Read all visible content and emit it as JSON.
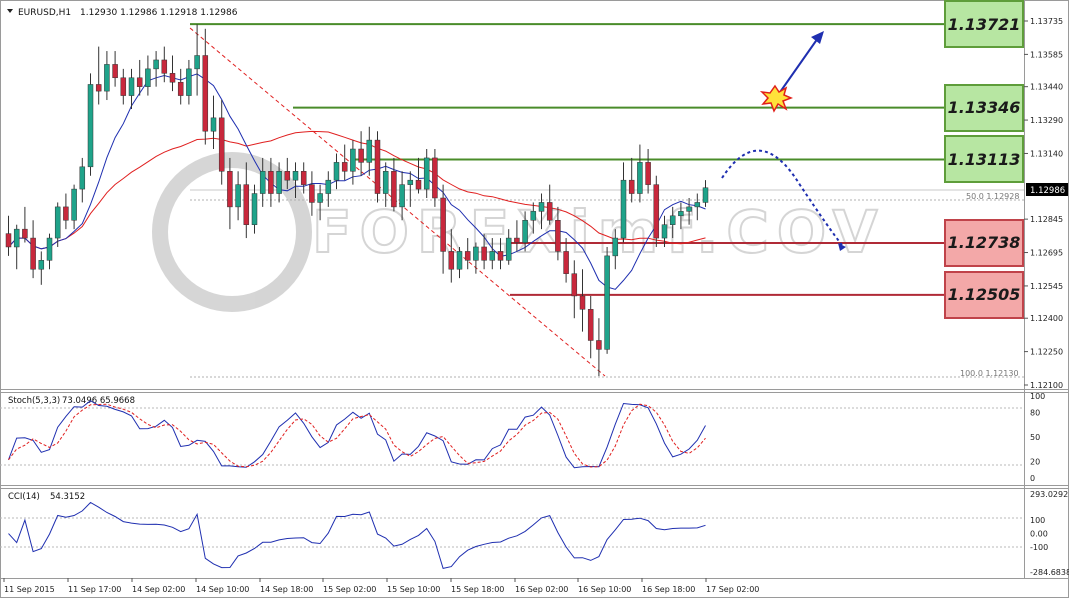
{
  "header": {
    "symbol": "EURUSD,H1",
    "ohlc": "1.12930 1.12986 1.12918 1.12986"
  },
  "price_axis": {
    "ticks": [
      "1.13735",
      "1.13585",
      "1.13440",
      "1.13290",
      "1.13140",
      "1.12845",
      "1.12695",
      "1.12545",
      "1.12400",
      "1.12250",
      "1.12100"
    ],
    "current_price": "1.12986"
  },
  "fibo": {
    "top_label": "50.0  1.12928",
    "bottom_label": "100.0  1.12130"
  },
  "levels": [
    {
      "price": "1.13721",
      "kind": "resistance"
    },
    {
      "price": "1.13346",
      "kind": "resistance"
    },
    {
      "price": "1.13113",
      "kind": "resistance"
    },
    {
      "price": "1.12738",
      "kind": "support"
    },
    {
      "price": "1.12505",
      "kind": "support"
    }
  ],
  "stoch": {
    "label": "Stoch(5,3,3)",
    "values": "73.0496 65.9668",
    "ticks": [
      "100",
      "80",
      "50",
      "20",
      "0"
    ]
  },
  "cci": {
    "label": "CCI(14)",
    "value": "54.3152",
    "ticks": [
      "293.0292",
      "100",
      "0.00",
      "-100",
      "-284.6838"
    ]
  },
  "time_axis": {
    "labels": [
      "11 Sep 2015",
      "11 Sep 17:00",
      "14 Sep 02:00",
      "14 Sep 10:00",
      "14 Sep 18:00",
      "15 Sep 02:00",
      "15 Sep 10:00",
      "15 Sep 18:00",
      "16 Sep 02:00",
      "16 Sep 10:00",
      "16 Sep 18:00",
      "17 Sep 02:00"
    ]
  },
  "colors": {
    "bull_candle": "#1fa38a",
    "bear_candle": "#c8283c",
    "ma_fast": "#1f2fb0",
    "ma_slow": "#e02020",
    "stoch_main": "#1f2fb0",
    "stoch_signal": "#e02020",
    "resistance_line": "#4a8c2a",
    "support_line": "#b02a36",
    "forecast_arrow": "#1f2fb0"
  },
  "chart_data": {
    "type": "candlestick",
    "ohlc": [
      [
        1.1278,
        1.1286,
        1.1268,
        1.1272
      ],
      [
        1.1272,
        1.1282,
        1.1262,
        1.128
      ],
      [
        1.128,
        1.129,
        1.1274,
        1.1276
      ],
      [
        1.1276,
        1.1284,
        1.1258,
        1.1262
      ],
      [
        1.1262,
        1.127,
        1.1255,
        1.1266
      ],
      [
        1.1266,
        1.1278,
        1.1262,
        1.1276
      ],
      [
        1.1276,
        1.1292,
        1.1272,
        1.129
      ],
      [
        1.129,
        1.1296,
        1.128,
        1.1284
      ],
      [
        1.1284,
        1.13,
        1.128,
        1.1298
      ],
      [
        1.1298,
        1.1312,
        1.1292,
        1.1308
      ],
      [
        1.1308,
        1.135,
        1.1304,
        1.1345
      ],
      [
        1.1345,
        1.1362,
        1.1336,
        1.1342
      ],
      [
        1.1342,
        1.136,
        1.1338,
        1.1354
      ],
      [
        1.1354,
        1.136,
        1.1344,
        1.1348
      ],
      [
        1.1348,
        1.1352,
        1.1336,
        1.134
      ],
      [
        1.134,
        1.1352,
        1.1334,
        1.1348
      ],
      [
        1.1348,
        1.1356,
        1.134,
        1.1344
      ],
      [
        1.1344,
        1.1358,
        1.134,
        1.1352
      ],
      [
        1.1352,
        1.136,
        1.1344,
        1.1356
      ],
      [
        1.1356,
        1.1362,
        1.1346,
        1.135
      ],
      [
        1.135,
        1.1358,
        1.1342,
        1.1346
      ],
      [
        1.1346,
        1.1352,
        1.1336,
        1.134
      ],
      [
        1.134,
        1.1356,
        1.1336,
        1.1352
      ],
      [
        1.1352,
        1.1372,
        1.134,
        1.1358
      ],
      [
        1.1358,
        1.137,
        1.1318,
        1.1324
      ],
      [
        1.1324,
        1.134,
        1.1316,
        1.133
      ],
      [
        1.133,
        1.1338,
        1.13,
        1.1306
      ],
      [
        1.1306,
        1.1312,
        1.128,
        1.129
      ],
      [
        1.129,
        1.1306,
        1.1284,
        1.13
      ],
      [
        1.13,
        1.131,
        1.1276,
        1.1282
      ],
      [
        1.1282,
        1.13,
        1.1278,
        1.1296
      ],
      [
        1.1296,
        1.1312,
        1.129,
        1.1306
      ],
      [
        1.1306,
        1.1312,
        1.129,
        1.1296
      ],
      [
        1.1296,
        1.131,
        1.1292,
        1.1306
      ],
      [
        1.1306,
        1.1312,
        1.1298,
        1.1302
      ],
      [
        1.1302,
        1.131,
        1.1294,
        1.1306
      ],
      [
        1.1306,
        1.131,
        1.1296,
        1.13
      ],
      [
        1.13,
        1.1306,
        1.1286,
        1.1292
      ],
      [
        1.1292,
        1.13,
        1.1284,
        1.1296
      ],
      [
        1.1296,
        1.1306,
        1.129,
        1.1302
      ],
      [
        1.1302,
        1.1314,
        1.1298,
        1.131
      ],
      [
        1.131,
        1.1318,
        1.1302,
        1.1306
      ],
      [
        1.1306,
        1.132,
        1.13,
        1.1316
      ],
      [
        1.1316,
        1.1324,
        1.1304,
        1.131
      ],
      [
        1.131,
        1.1326,
        1.1304,
        1.132
      ],
      [
        1.132,
        1.1324,
        1.1292,
        1.1296
      ],
      [
        1.1296,
        1.131,
        1.129,
        1.1306
      ],
      [
        1.1306,
        1.1312,
        1.1288,
        1.129
      ],
      [
        1.129,
        1.1306,
        1.1284,
        1.13
      ],
      [
        1.13,
        1.1306,
        1.129,
        1.1302
      ],
      [
        1.1302,
        1.1312,
        1.1296,
        1.1298
      ],
      [
        1.1298,
        1.1316,
        1.1294,
        1.1312
      ],
      [
        1.1312,
        1.1316,
        1.129,
        1.1294
      ],
      [
        1.1294,
        1.13,
        1.126,
        1.127
      ],
      [
        1.127,
        1.128,
        1.1256,
        1.1262
      ],
      [
        1.1262,
        1.1272,
        1.1258,
        1.127
      ],
      [
        1.127,
        1.1276,
        1.1262,
        1.1266
      ],
      [
        1.1266,
        1.1274,
        1.126,
        1.1272
      ],
      [
        1.1272,
        1.1278,
        1.1262,
        1.1266
      ],
      [
        1.1266,
        1.1276,
        1.1262,
        1.127
      ],
      [
        1.127,
        1.1276,
        1.1262,
        1.1266
      ],
      [
        1.1266,
        1.128,
        1.1264,
        1.1276
      ],
      [
        1.1276,
        1.1284,
        1.127,
        1.1274
      ],
      [
        1.1274,
        1.1288,
        1.127,
        1.1284
      ],
      [
        1.1284,
        1.1292,
        1.1278,
        1.1288
      ],
      [
        1.1288,
        1.1296,
        1.128,
        1.1292
      ],
      [
        1.1292,
        1.13,
        1.1282,
        1.1284
      ],
      [
        1.1284,
        1.129,
        1.1266,
        1.127
      ],
      [
        1.127,
        1.1276,
        1.1256,
        1.126
      ],
      [
        1.126,
        1.1266,
        1.124,
        1.125
      ],
      [
        1.125,
        1.1262,
        1.1234,
        1.1244
      ],
      [
        1.1244,
        1.125,
        1.1222,
        1.123
      ],
      [
        1.123,
        1.124,
        1.1214,
        1.1226
      ],
      [
        1.1226,
        1.1272,
        1.1224,
        1.1268
      ],
      [
        1.1268,
        1.128,
        1.1262,
        1.1276
      ],
      [
        1.1276,
        1.131,
        1.1274,
        1.1302
      ],
      [
        1.1302,
        1.1312,
        1.1292,
        1.1296
      ],
      [
        1.1296,
        1.1318,
        1.1292,
        1.131
      ],
      [
        1.131,
        1.1316,
        1.1296,
        1.13
      ],
      [
        1.13,
        1.1304,
        1.1272,
        1.1276
      ],
      [
        1.1276,
        1.1286,
        1.1272,
        1.1282
      ],
      [
        1.1282,
        1.129,
        1.1276,
        1.1286
      ],
      [
        1.1286,
        1.1292,
        1.128,
        1.1288
      ],
      [
        1.1288,
        1.1294,
        1.1282,
        1.129
      ],
      [
        1.129,
        1.1296,
        1.1284,
        1.1292
      ],
      [
        1.1292,
        1.1302,
        1.129,
        1.12986
      ]
    ]
  }
}
